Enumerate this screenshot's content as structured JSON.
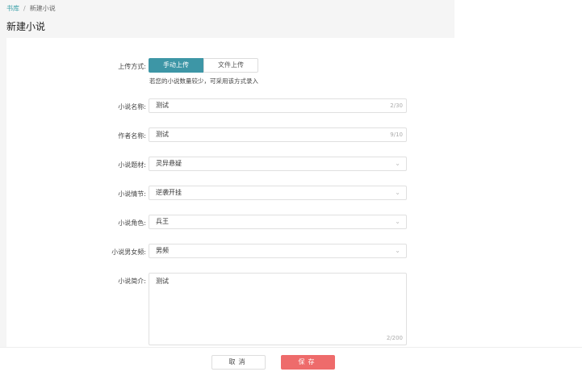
{
  "breadcrumb": {
    "root": "书库",
    "current": "新建小说"
  },
  "page_title": "新建小说",
  "form": {
    "upload": {
      "label": "上传方式:",
      "options": [
        "手动上传",
        "文件上传"
      ],
      "selected": "手动上传",
      "hint": "若您的小说数量较少，可采用该方式录入"
    },
    "name": {
      "label": "小说名称:",
      "value": "测试",
      "count": "2/30"
    },
    "author": {
      "label": "作者名称:",
      "value": "测试",
      "count": "9/10"
    },
    "theme": {
      "label": "小说题材:",
      "value": "灵异悬疑"
    },
    "plot": {
      "label": "小说情节:",
      "value": "逆袭开挂"
    },
    "role": {
      "label": "小说角色:",
      "value": "兵王"
    },
    "gender": {
      "label": "小说男女频:",
      "value": "男频"
    },
    "intro": {
      "label": "小说简介:",
      "value": "测试",
      "count": "2/200"
    }
  },
  "buttons": {
    "cancel": "取消",
    "save": "保存"
  },
  "colors": {
    "accent": "#3d96a6",
    "save": "#ee6b6b"
  }
}
